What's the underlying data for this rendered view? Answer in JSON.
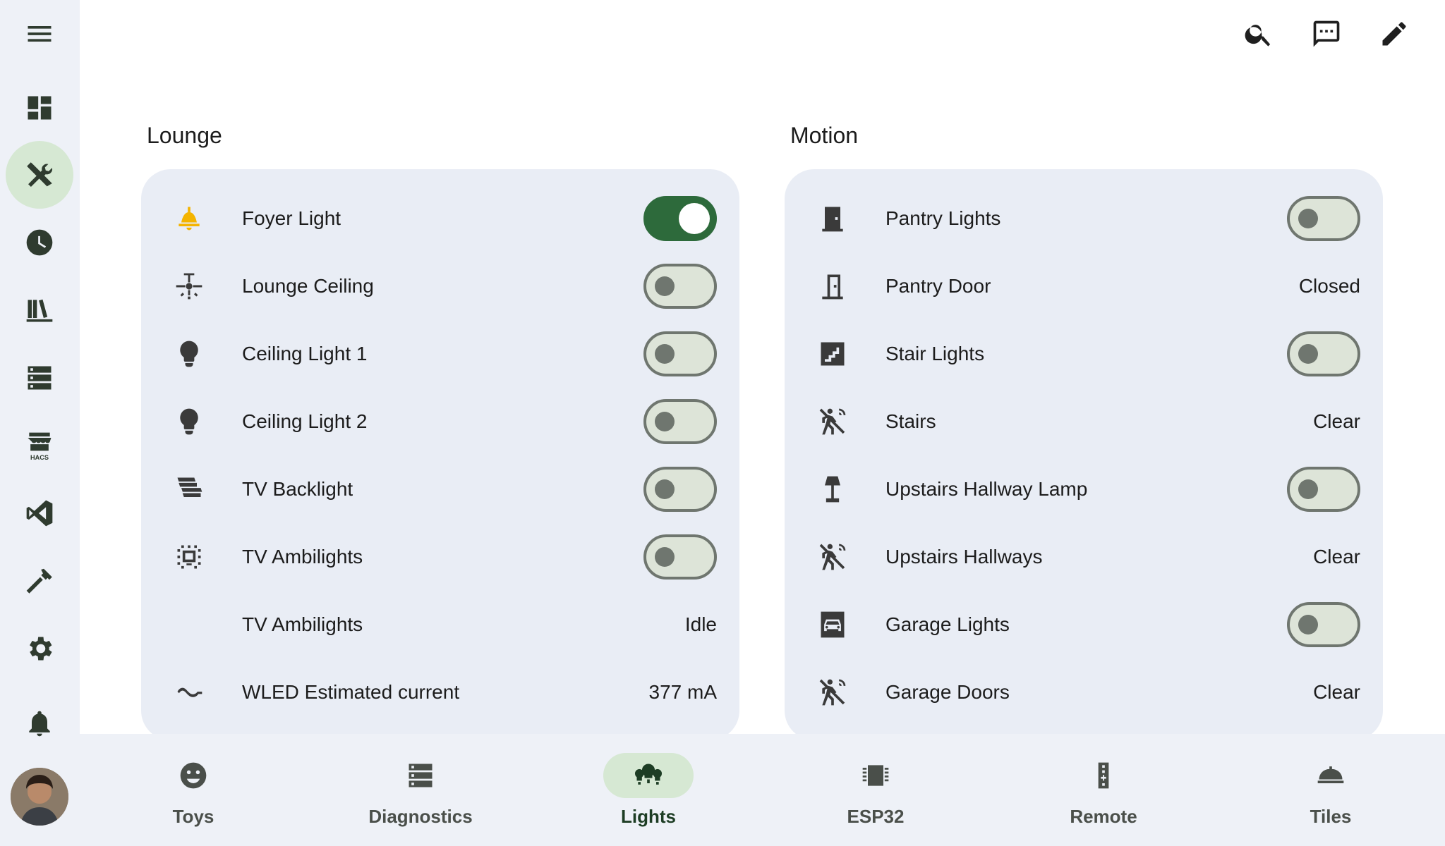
{
  "colors": {
    "sidebar_bg": "#eef1f7",
    "card_bg": "#e9edf5",
    "accent_green": "#2d6a3b",
    "active_pill": "#d6e8d3",
    "foyer_icon": "#f4b400"
  },
  "sidebar": {
    "items": [
      {
        "icon": "menu-icon"
      },
      {
        "icon": "dashboard-icon"
      },
      {
        "icon": "tools-icon",
        "active": true
      },
      {
        "icon": "history-clock-icon"
      },
      {
        "icon": "library-icon"
      },
      {
        "icon": "server-icon"
      },
      {
        "icon": "hacs-store-icon"
      },
      {
        "icon": "vscode-icon"
      },
      {
        "icon": "hammer-icon"
      },
      {
        "icon": "gear-icon"
      },
      {
        "icon": "bell-icon"
      }
    ]
  },
  "header": {
    "actions": [
      "search-icon",
      "assist-chat-icon",
      "edit-pencil-icon"
    ]
  },
  "sections": {
    "lounge": {
      "title": "Lounge",
      "rows": [
        {
          "label": "Foyer Light",
          "icon": "ceiling-bell-light-icon",
          "control": "toggle",
          "on": true
        },
        {
          "label": "Lounge Ceiling",
          "icon": "ceiling-fan-light-icon",
          "control": "toggle",
          "on": false
        },
        {
          "label": "Ceiling Light 1",
          "icon": "lightbulb-icon",
          "control": "toggle",
          "on": false
        },
        {
          "label": "Ceiling Light 2",
          "icon": "lightbulb-icon",
          "control": "toggle",
          "on": false
        },
        {
          "label": "TV Backlight",
          "icon": "led-strip-icon",
          "control": "toggle",
          "on": false
        },
        {
          "label": "TV Ambilights",
          "icon": "tv-ambilight-icon",
          "control": "toggle",
          "on": false
        },
        {
          "label": "TV Ambilights",
          "icon": "",
          "control": "state",
          "state": "Idle"
        },
        {
          "label": "WLED Estimated current",
          "icon": "current-ac-icon",
          "control": "state",
          "state": "377 mA"
        }
      ]
    },
    "motion": {
      "title": "Motion",
      "rows": [
        {
          "label": "Pantry Lights",
          "icon": "door-icon",
          "control": "toggle",
          "on": false
        },
        {
          "label": "Pantry Door",
          "icon": "door-closed-icon",
          "control": "state",
          "state": "Closed"
        },
        {
          "label": "Stair Lights",
          "icon": "stairs-icon",
          "control": "toggle",
          "on": false
        },
        {
          "label": "Stairs",
          "icon": "motion-sensor-icon",
          "control": "state",
          "state": "Clear"
        },
        {
          "label": "Upstairs Hallway Lamp",
          "icon": "floor-lamp-icon",
          "control": "toggle",
          "on": false
        },
        {
          "label": "Upstairs Hallways",
          "icon": "motion-sensor-icon",
          "control": "state",
          "state": "Clear"
        },
        {
          "label": "Garage Lights",
          "icon": "car-icon",
          "control": "toggle",
          "on": false
        },
        {
          "label": "Garage Doors",
          "icon": "motion-sensor-icon",
          "control": "state",
          "state": "Clear"
        }
      ]
    }
  },
  "bottom_nav": {
    "tabs": [
      {
        "label": "Toys",
        "icon": "emoticon-icon"
      },
      {
        "label": "Diagnostics",
        "icon": "server-icon"
      },
      {
        "label": "Lights",
        "icon": "lights-chandelier-icon",
        "active": true
      },
      {
        "label": "ESP32",
        "icon": "chip-icon"
      },
      {
        "label": "Remote",
        "icon": "remote-icon"
      },
      {
        "label": "Tiles",
        "icon": "cloche-icon"
      }
    ]
  }
}
